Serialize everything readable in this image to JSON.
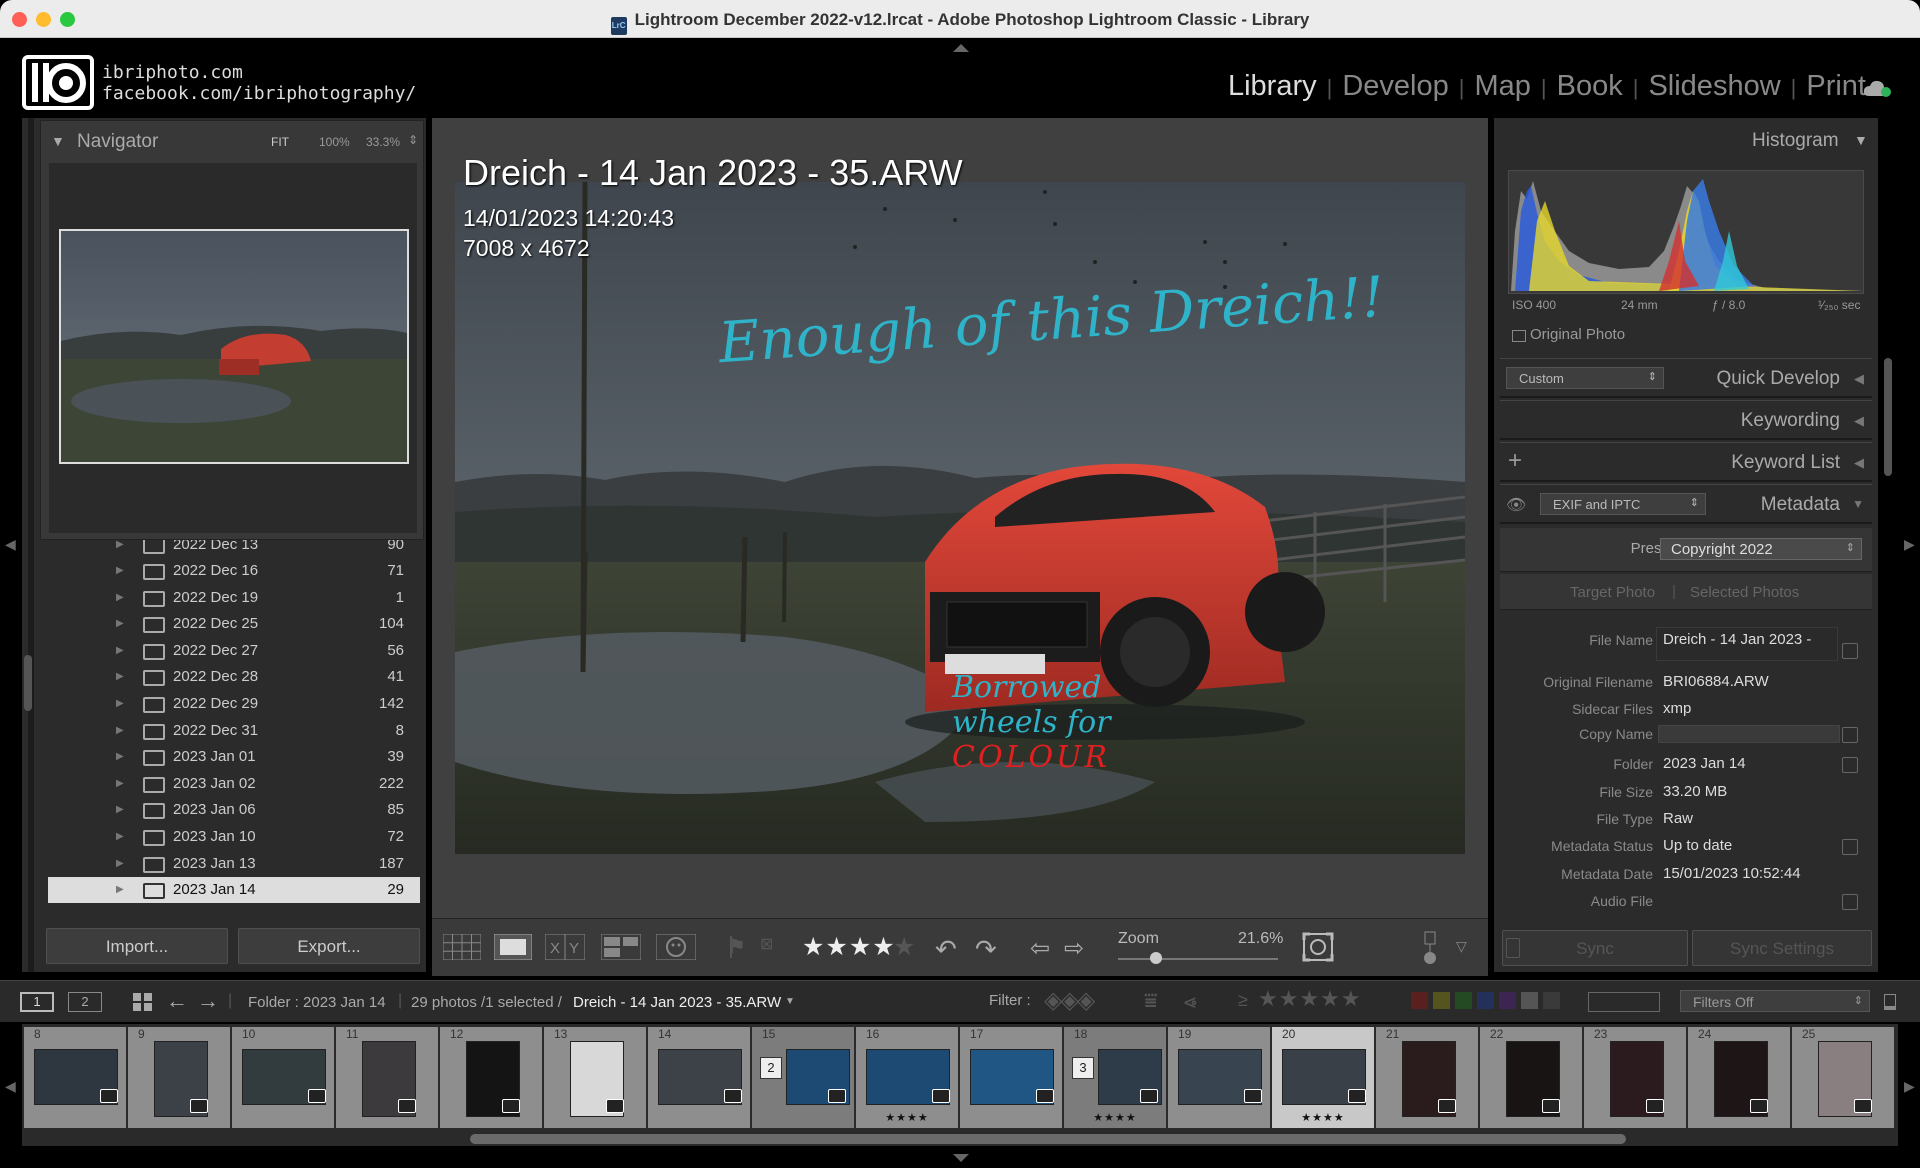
{
  "window": {
    "title": "Lightroom December 2022-v12.lrcat - Adobe Photoshop Lightroom Classic - Library"
  },
  "identity": {
    "line1": "ibriphoto.com",
    "line2": "facebook.com/ibriphotography/"
  },
  "modules": [
    "Library",
    "Develop",
    "Map",
    "Book",
    "Slideshow",
    "Print"
  ],
  "active_module": "Library",
  "navigator": {
    "title": "Navigator",
    "zoom_fit": "FIT",
    "zoom_100": "100%",
    "zoom_333": "33.3%"
  },
  "folders": [
    {
      "name": "2022 Dec 13",
      "count": "90"
    },
    {
      "name": "2022 Dec 16",
      "count": "71"
    },
    {
      "name": "2022 Dec 19",
      "count": "1"
    },
    {
      "name": "2022 Dec 25",
      "count": "104"
    },
    {
      "name": "2022 Dec 27",
      "count": "56"
    },
    {
      "name": "2022 Dec 28",
      "count": "41"
    },
    {
      "name": "2022 Dec 29",
      "count": "142"
    },
    {
      "name": "2022 Dec 31",
      "count": "8"
    },
    {
      "name": "2023 Jan 01",
      "count": "39"
    },
    {
      "name": "2023 Jan 02",
      "count": "222"
    },
    {
      "name": "2023 Jan 06",
      "count": "85"
    },
    {
      "name": "2023 Jan 10",
      "count": "72"
    },
    {
      "name": "2023 Jan 13",
      "count": "187"
    },
    {
      "name": "2023 Jan 14",
      "count": "29"
    }
  ],
  "left_buttons": {
    "import": "Import...",
    "export": "Export..."
  },
  "photo": {
    "title": "Dreich - 14 Jan 2023 - 35.ARW",
    "datetime": "14/01/2023 14:20:43",
    "dimensions": "7008 x 4672",
    "annotation_top": "Enough of this Dreich!!",
    "annotation_mid1": "Borrowed",
    "annotation_mid2": "wheels for",
    "annotation_mid3": "COLOUR"
  },
  "toolbar": {
    "stars": "★★★★",
    "zoom_label": "Zoom",
    "zoom_value": "21.6%"
  },
  "zoom_level": 0.216,
  "rating": 4,
  "histogram": {
    "title": "Histogram",
    "iso": "ISO 400",
    "focal": "24 mm",
    "aperture": "ƒ / 8.0",
    "shutter": "¹⁄₂₅₀ sec",
    "original_photo": "Original Photo"
  },
  "quick_develop": {
    "title": "Quick Develop",
    "preset": "Custom"
  },
  "keywording": {
    "title": "Keywording"
  },
  "keyword_list": {
    "title": "Keyword List"
  },
  "metadata": {
    "title": "Metadata",
    "view": "EXIF and IPTC",
    "preset_label": "Preset",
    "preset_value": "Copyright 2022",
    "target_photo": "Target Photo",
    "selected_photos": "Selected Photos",
    "rows": [
      {
        "label": "File Name",
        "value": "Dreich - 14 Jan 2023 -"
      },
      {
        "label": "Original Filename",
        "value": "BRI06884.ARW"
      },
      {
        "label": "Sidecar Files",
        "value": "xmp"
      },
      {
        "label": "Copy Name",
        "value": ""
      },
      {
        "label": "Folder",
        "value": "2023 Jan 14"
      },
      {
        "label": "File Size",
        "value": "33.20 MB"
      },
      {
        "label": "File Type",
        "value": "Raw"
      },
      {
        "label": "Metadata Status",
        "value": "Up to date"
      },
      {
        "label": "Metadata Date",
        "value": "15/01/2023 10:52:44"
      },
      {
        "label": "Audio File",
        "value": ""
      }
    ]
  },
  "right_buttons": {
    "sync": "Sync",
    "sync_settings": "Sync Settings"
  },
  "filmstrip_bar": {
    "view1": "1",
    "view2": "2",
    "folder": "Folder : 2023 Jan 14",
    "count": "29 photos /1 selected /",
    "selected_file": "Dreich - 14 Jan 2023 - 35.ARW",
    "filter_label": "Filter :",
    "rating_op": "≥",
    "filter_stars": "★★★★★",
    "filters_off": "Filters Off"
  },
  "filmstrip": [
    {
      "n": "8",
      "stars": "",
      "tone": "#2e3740",
      "kind": "land"
    },
    {
      "n": "9",
      "stars": "",
      "tone": "#3b4147",
      "kind": "port"
    },
    {
      "n": "10",
      "stars": "",
      "tone": "#323c3e",
      "kind": "land"
    },
    {
      "n": "11",
      "stars": "",
      "tone": "#3c3a3c",
      "kind": "port"
    },
    {
      "n": "12",
      "stars": "",
      "tone": "#141414",
      "kind": "port"
    },
    {
      "n": "13",
      "stars": "",
      "tone": "#d8d8d8",
      "kind": "port"
    },
    {
      "n": "14",
      "stars": "",
      "tone": "#3c4248",
      "kind": "land"
    },
    {
      "n": "15",
      "stars": "",
      "tone": "#1d4a73",
      "kind": "stack",
      "stack": "2"
    },
    {
      "n": "16",
      "stars": "★★★★",
      "tone": "#1d4a73",
      "kind": "land"
    },
    {
      "n": "17",
      "stars": "",
      "tone": "#1f5683",
      "kind": "land"
    },
    {
      "n": "18",
      "stars": "★★★★",
      "tone": "#2e3b49",
      "kind": "stack",
      "stack": "3"
    },
    {
      "n": "19",
      "stars": "",
      "tone": "#394451",
      "kind": "land"
    },
    {
      "n": "20",
      "stars": "★★★★",
      "tone": "#3a4047",
      "kind": "land",
      "selected": true
    },
    {
      "n": "21",
      "stars": "",
      "tone": "#2a1c1c",
      "kind": "port"
    },
    {
      "n": "22",
      "stars": "",
      "tone": "#181414",
      "kind": "port"
    },
    {
      "n": "23",
      "stars": "",
      "tone": "#2b1b1f",
      "kind": "port"
    },
    {
      "n": "24",
      "stars": "",
      "tone": "#1e1616",
      "kind": "port"
    },
    {
      "n": "25",
      "stars": "",
      "tone": "#8a7f80",
      "kind": "port"
    }
  ],
  "colors": {
    "accent_red": "#d8463c",
    "annotation_cyan": "#2fb3c9",
    "annotation_red": "#e02020"
  }
}
